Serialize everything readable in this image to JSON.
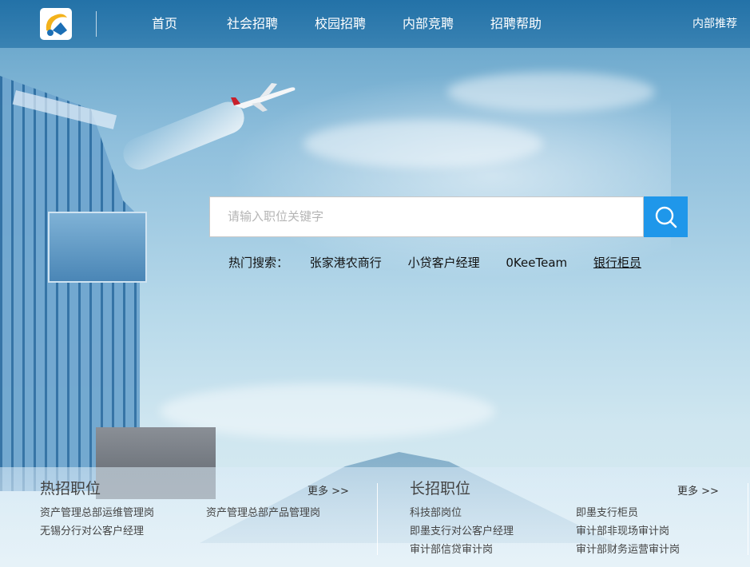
{
  "header": {
    "nav": [
      "首页",
      "社会招聘",
      "校园招聘",
      "内部竞聘",
      "招聘帮助"
    ],
    "right_link": "内部推荐"
  },
  "search": {
    "placeholder": "请输入职位关键字",
    "button_icon": "search-icon"
  },
  "hot_search": {
    "label": "热门搜索：",
    "items": [
      "张家港农商行",
      "小贷客户经理",
      "0KeeTeam",
      "银行柜员"
    ]
  },
  "hot_jobs": {
    "title": "热招职位",
    "more": "更多 >>",
    "items": [
      "资产管理总部运维管理岗",
      "资产管理总部产品管理岗",
      "无锡分行对公客户经理"
    ]
  },
  "long_jobs": {
    "title": "长招职位",
    "more": "更多 >>",
    "items": [
      "科技部岗位",
      "即墨支行柜员",
      "即墨支行对公客户经理",
      "审计部非现场审计岗",
      "审计部信贷审计岗",
      "审计部财务运营审计岗"
    ]
  },
  "colors": {
    "header_bg": "#1e6ea5",
    "search_button": "#1f97ea",
    "logo_yellow": "#f3b21b",
    "logo_blue": "#1c6fb5"
  }
}
